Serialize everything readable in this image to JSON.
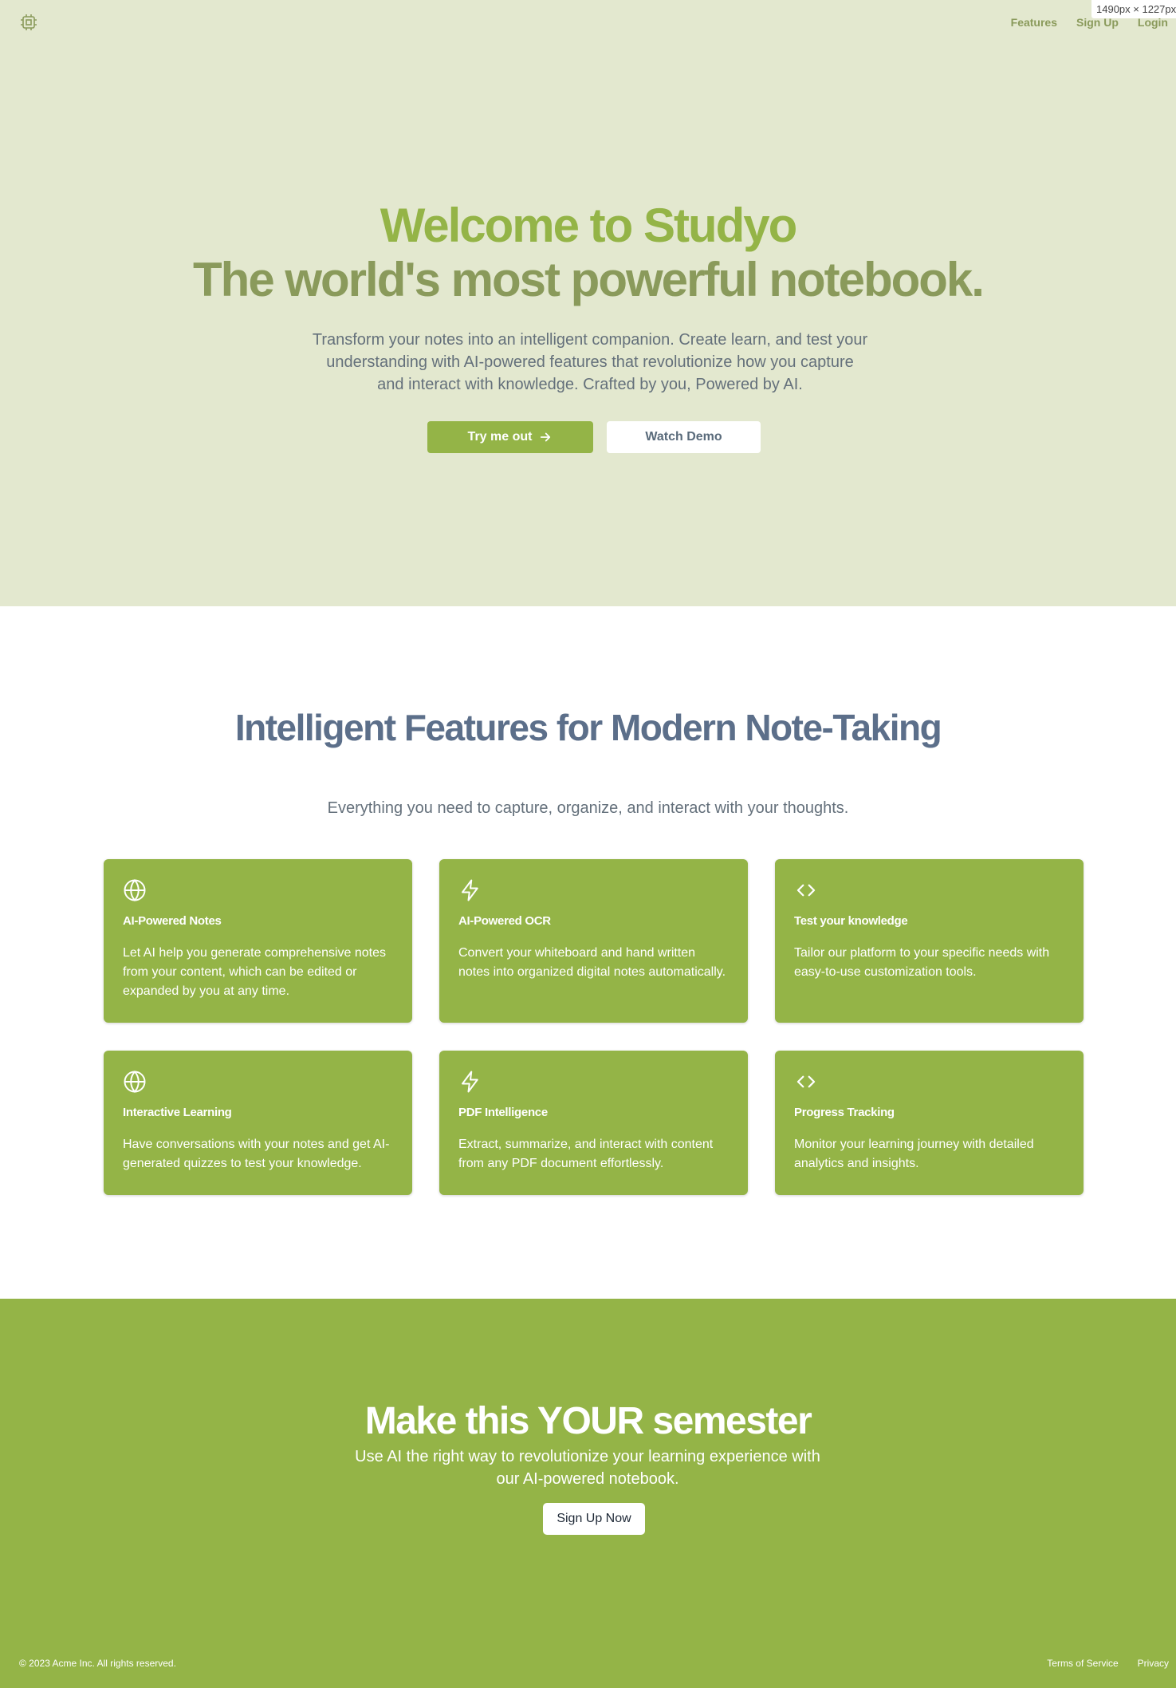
{
  "window": {
    "size_label": "1490px × 1227px"
  },
  "header": {
    "logo_icon": "chip-icon",
    "nav": [
      {
        "label": "Features"
      },
      {
        "label": "Sign Up"
      },
      {
        "label": "Login"
      }
    ]
  },
  "hero": {
    "title_line1": "Welcome to Studyo",
    "title_line2": "The world's most powerful notebook.",
    "lead": "Transform your notes into an intelligent companion. Create learn, and test your understanding with AI-powered features that revolutionize how you capture and interact with knowledge. Crafted by you, Powered by AI.",
    "primary_button": "Try me out",
    "primary_button_icon": "arrow-right-icon",
    "secondary_button": "Watch Demo"
  },
  "features": {
    "title": "Intelligent Features for Modern Note-Taking",
    "subtitle": "Everything you need to capture, organize, and interact with your thoughts.",
    "cards": [
      {
        "icon": "globe-icon",
        "title": "AI-Powered Notes",
        "desc": "Let AI help you generate comprehensive notes from your content, which can be edited or expanded by you at any time."
      },
      {
        "icon": "lightning-icon",
        "title": "AI-Powered OCR",
        "desc": "Convert your whiteboard and hand written notes into organized digital notes automatically."
      },
      {
        "icon": "code-icon",
        "title": "Test your knowledge",
        "desc": "Tailor our platform to your specific needs with easy-to-use customization tools."
      },
      {
        "icon": "globe-icon",
        "title": "Interactive Learning",
        "desc": "Have conversations with your notes and get AI-generated quizzes to test your knowledge."
      },
      {
        "icon": "lightning-icon",
        "title": "PDF Intelligence",
        "desc": "Extract, summarize, and interact with content from any PDF document effortlessly."
      },
      {
        "icon": "code-icon",
        "title": "Progress Tracking",
        "desc": "Monitor your learning journey with detailed analytics and insights."
      }
    ]
  },
  "cta": {
    "title": "Make this YOUR semester",
    "subtitle": "Use AI the right way to revolutionize your learning experience with our AI-powered notebook.",
    "button": "Sign Up Now"
  },
  "footer": {
    "copyright": "© 2023 Acme Inc. All rights reserved.",
    "links": [
      {
        "label": "Terms of Service"
      },
      {
        "label": "Privacy"
      }
    ]
  },
  "colors": {
    "hero_bg": "#e3e8cf",
    "accent": "#94b447",
    "olive": "#8a9a5b",
    "slate": "#5c6f8a",
    "text_muted": "#64707b"
  }
}
